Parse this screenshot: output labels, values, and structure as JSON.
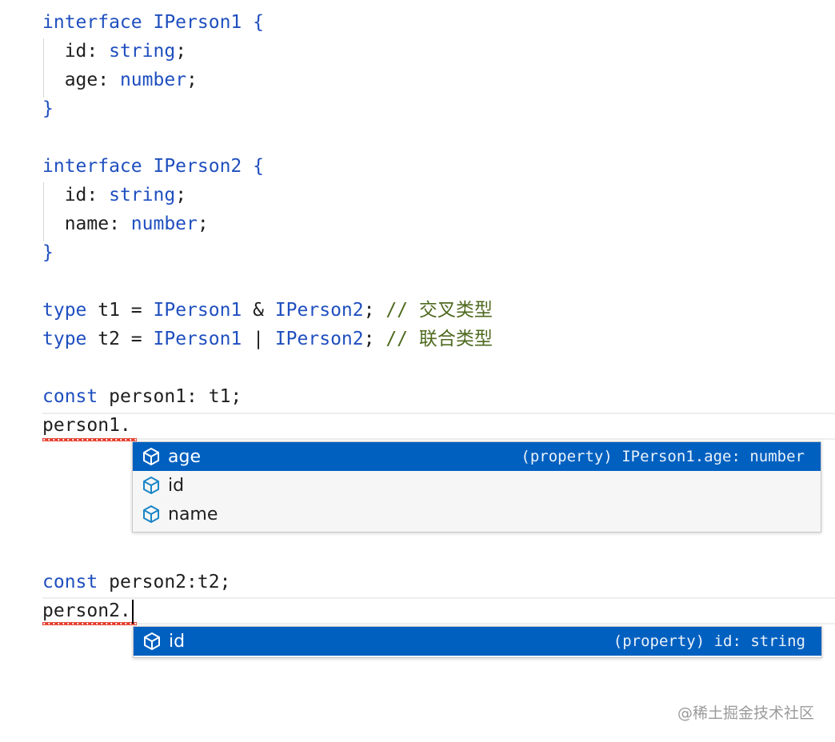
{
  "code_lines": [
    {
      "tokens": [
        {
          "t": "interface ",
          "c": "kw"
        },
        {
          "t": "IPerson1",
          "c": "ty"
        },
        {
          "t": " {",
          "c": "kw"
        }
      ]
    },
    {
      "tokens": [
        {
          "t": "  id",
          "c": "pl"
        },
        {
          "t": ": ",
          "c": "pl"
        },
        {
          "t": "string",
          "c": "ty"
        },
        {
          "t": ";",
          "c": "pl"
        }
      ]
    },
    {
      "tokens": [
        {
          "t": "  age",
          "c": "pl"
        },
        {
          "t": ": ",
          "c": "pl"
        },
        {
          "t": "number",
          "c": "ty"
        },
        {
          "t": ";",
          "c": "pl"
        }
      ]
    },
    {
      "tokens": [
        {
          "t": "}",
          "c": "kw"
        }
      ]
    },
    {
      "tokens": []
    },
    {
      "tokens": [
        {
          "t": "interface ",
          "c": "kw"
        },
        {
          "t": "IPerson2",
          "c": "ty"
        },
        {
          "t": " {",
          "c": "kw"
        }
      ]
    },
    {
      "tokens": [
        {
          "t": "  id",
          "c": "pl"
        },
        {
          "t": ": ",
          "c": "pl"
        },
        {
          "t": "string",
          "c": "ty"
        },
        {
          "t": ";",
          "c": "pl"
        }
      ]
    },
    {
      "tokens": [
        {
          "t": "  name",
          "c": "pl"
        },
        {
          "t": ": ",
          "c": "pl"
        },
        {
          "t": "number",
          "c": "ty"
        },
        {
          "t": ";",
          "c": "pl"
        }
      ]
    },
    {
      "tokens": [
        {
          "t": "}",
          "c": "kw"
        }
      ]
    },
    {
      "tokens": []
    },
    {
      "tokens": [
        {
          "t": "type ",
          "c": "kw"
        },
        {
          "t": "t1 = ",
          "c": "pl"
        },
        {
          "t": "IPerson1",
          "c": "ty"
        },
        {
          "t": " & ",
          "c": "pl"
        },
        {
          "t": "IPerson2",
          "c": "ty"
        },
        {
          "t": "; ",
          "c": "pl"
        },
        {
          "t": "// 交叉类型",
          "c": "cm"
        }
      ]
    },
    {
      "tokens": [
        {
          "t": "type ",
          "c": "kw"
        },
        {
          "t": "t2 = ",
          "c": "pl"
        },
        {
          "t": "IPerson1",
          "c": "ty"
        },
        {
          "t": " | ",
          "c": "pl"
        },
        {
          "t": "IPerson2",
          "c": "ty"
        },
        {
          "t": "; ",
          "c": "pl"
        },
        {
          "t": "// 联合类型",
          "c": "cm"
        }
      ]
    },
    {
      "tokens": []
    },
    {
      "tokens": [
        {
          "t": "const ",
          "c": "kw"
        },
        {
          "t": "person1: t1;",
          "c": "pl"
        }
      ]
    },
    {
      "tokens": [
        {
          "t": "person1.",
          "c": "pl"
        }
      ]
    }
  ],
  "code_lines_b": [
    {
      "tokens": [
        {
          "t": "const ",
          "c": "kw"
        },
        {
          "t": "person2:t2;",
          "c": "pl"
        }
      ]
    },
    {
      "tokens": [
        {
          "t": "person2.",
          "c": "pl"
        }
      ]
    }
  ],
  "suggest1": {
    "items": [
      {
        "label": "age",
        "detail": "(property) IPerson1.age: number",
        "selected": true,
        "icon": "property-cube-icon"
      },
      {
        "label": "id",
        "detail": "",
        "selected": false,
        "icon": "property-cube-icon"
      },
      {
        "label": "name",
        "detail": "",
        "selected": false,
        "icon": "property-cube-icon"
      }
    ]
  },
  "suggest2": {
    "items": [
      {
        "label": "id",
        "detail": "(property) id: string",
        "selected": true,
        "icon": "property-cube-icon"
      }
    ]
  },
  "watermark": "@稀土掘金技术社区",
  "colors": {
    "keyword": "#1f4fbf",
    "comment": "#4f6a1f",
    "selection": "#0060c0",
    "error": "#e51400"
  }
}
